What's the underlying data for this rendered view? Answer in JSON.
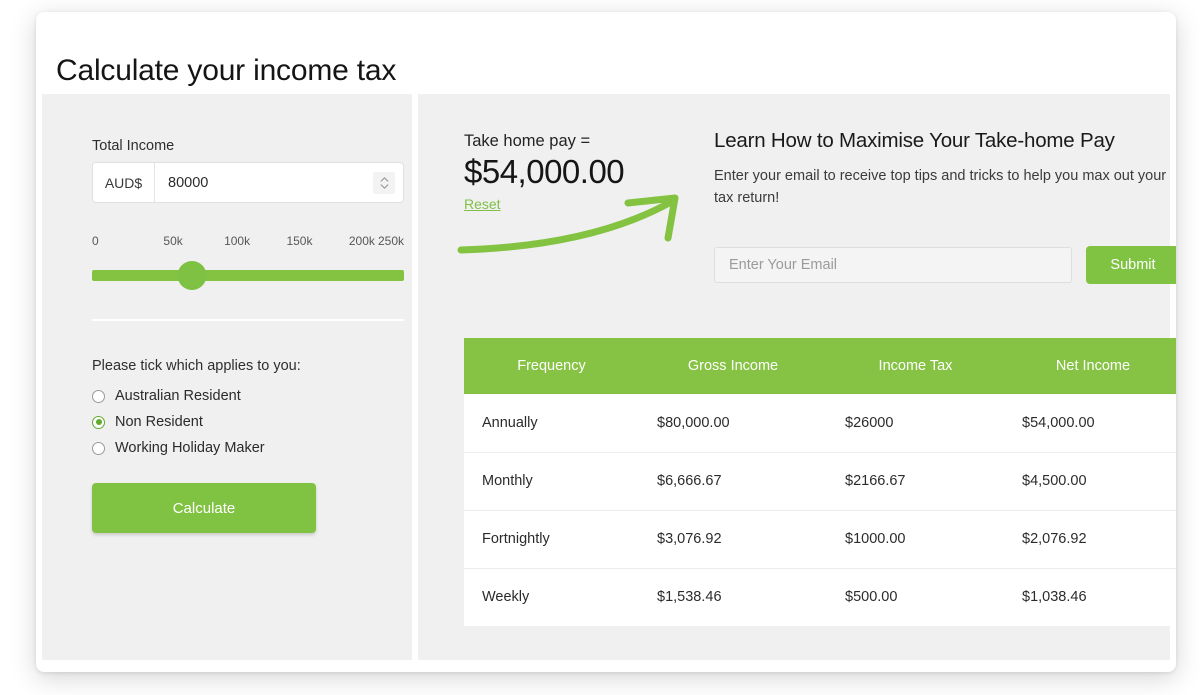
{
  "header": {
    "title": "Calculate your income tax"
  },
  "calculator": {
    "income_label": "Total Income",
    "currency_prefix": "AUD$",
    "income_value": "80000",
    "slider": {
      "ticks": [
        "0",
        "50k",
        "100k",
        "150k",
        "200k",
        "250k"
      ],
      "min": 0,
      "max": 250000,
      "value": 80000,
      "thumb_percent": 32
    },
    "residency_question": "Please tick which applies to you:",
    "residency_options": [
      {
        "label": "Australian Resident",
        "selected": false
      },
      {
        "label": "Non Resident",
        "selected": true
      },
      {
        "label": "Working Holiday Maker",
        "selected": false
      }
    ],
    "calculate_label": "Calculate"
  },
  "results": {
    "takehome_label": "Take home pay =",
    "takehome_amount": "$54,000.00",
    "reset_label": "Reset"
  },
  "promo": {
    "title": "Learn How to Maximise Your Take-home Pay",
    "body": "Enter your email to receive top tips and tricks to help you max out your tax return!",
    "email_placeholder": "Enter Your Email",
    "email_value": "",
    "submit_label": "Submit"
  },
  "table": {
    "columns": [
      "Frequency",
      "Gross Income",
      "Income Tax",
      "Net Income"
    ],
    "rows": [
      {
        "frequency": "Annually",
        "gross": "$80,000.00",
        "tax": "$26000",
        "net": "$54,000.00"
      },
      {
        "frequency": "Monthly",
        "gross": "$6,666.67",
        "tax": "$2166.67",
        "net": "$4,500.00"
      },
      {
        "frequency": "Fortnightly",
        "gross": "$3,076.92",
        "tax": "$1000.00",
        "net": "$2,076.92"
      },
      {
        "frequency": "Weekly",
        "gross": "$1,538.46",
        "tax": "$500.00",
        "net": "$1,038.46"
      }
    ]
  },
  "colors": {
    "brand_green": "#80c342",
    "header_green": "#86c344",
    "panel_gray": "#f0f0f0",
    "text_dark": "#2b2b2b"
  }
}
